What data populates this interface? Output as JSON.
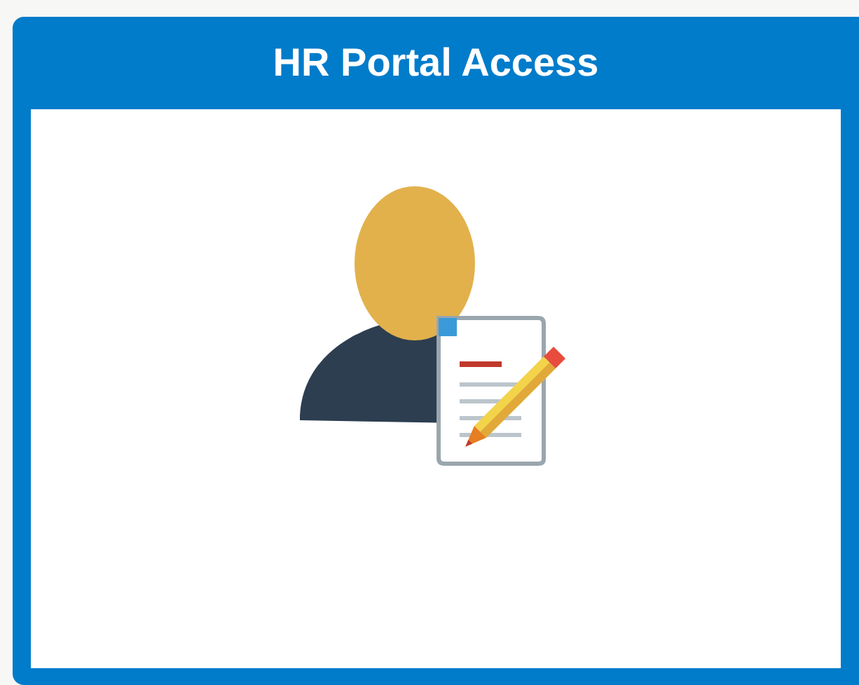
{
  "tile": {
    "title": "HR Portal Access"
  }
}
